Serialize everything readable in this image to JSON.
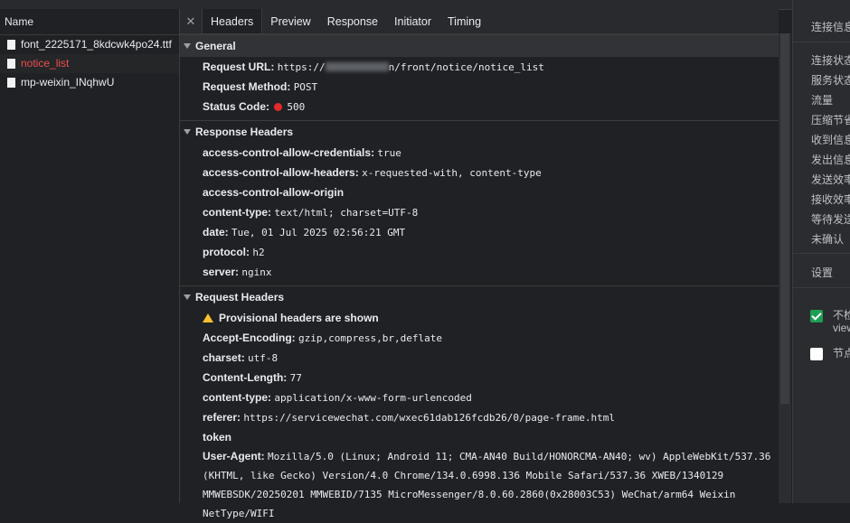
{
  "files": {
    "header": "Name",
    "items": [
      {
        "name": "font_2225171_8kdcwk4po24.ttf",
        "error": false
      },
      {
        "name": "notice_list",
        "error": true
      },
      {
        "name": "mp-weixin_INqhwU",
        "error": false
      }
    ]
  },
  "tabs": [
    "Headers",
    "Preview",
    "Response",
    "Initiator",
    "Timing"
  ],
  "general": {
    "title": "General",
    "request_url_label": "Request URL:",
    "request_url_prefix": "https://",
    "request_url_suffix": "n/front/notice/notice_list",
    "request_method_label": "Request Method:",
    "request_method": "POST",
    "status_code_label": "Status Code:",
    "status_code": "500"
  },
  "response_headers": {
    "title": "Response Headers",
    "rows": [
      {
        "k": "access-control-allow-credentials:",
        "v": "true"
      },
      {
        "k": "access-control-allow-headers:",
        "v": "x-requested-with, content-type"
      },
      {
        "k": "access-control-allow-origin",
        "v": ""
      },
      {
        "k": "content-type:",
        "v": "text/html; charset=UTF-8"
      },
      {
        "k": "date:",
        "v": "Tue, 01 Jul 2025 02:56:21 GMT"
      },
      {
        "k": "protocol:",
        "v": "h2"
      },
      {
        "k": "server:",
        "v": "nginx"
      }
    ]
  },
  "request_headers": {
    "title": "Request Headers",
    "warning": "Provisional headers are shown",
    "rows": [
      {
        "k": "Accept-Encoding:",
        "v": "gzip,compress,br,deflate"
      },
      {
        "k": "charset:",
        "v": "utf-8"
      },
      {
        "k": "Content-Length:",
        "v": "77"
      },
      {
        "k": "content-type:",
        "v": "application/x-www-form-urlencoded"
      },
      {
        "k": "referer:",
        "v": "https://servicewechat.com/wxec61dab126fcdb26/0/page-frame.html"
      },
      {
        "k": "token",
        "v": ""
      }
    ],
    "user_agent_label": "User-Agent:",
    "user_agent": "Mozilla/5.0 (Linux; Android 11; CMA-AN40 Build/HONORCMA-AN40; wv) AppleWebKit/537.36 (KHTML, like Gecko) Version/4.0 Chrome/134.0.6998.136 Mobile Safari/537.36 XWEB/1340129 MMWEBSDK/20250201 MMWEBID/7135 MicroMessenger/8.0.60.2860(0x28003C53) WeChat/arm64 Weixin NetType/WIFI"
  },
  "right_panel": {
    "title": "连接信息",
    "items": [
      "连接状态",
      "服务状态",
      "流量",
      "压缩节省",
      "收到信息",
      "发出信息",
      "发送效率",
      "接收效率",
      "等待发送",
      "未确认"
    ],
    "settings": "设置",
    "option1": "不检查",
    "option1_line2": "view",
    "option2": "节点"
  },
  "colors": {
    "error": "#ee4e4e",
    "status_dot": "#e12a2a",
    "checkbox_on": "#1e9e55",
    "warning": "#fbc02d"
  }
}
